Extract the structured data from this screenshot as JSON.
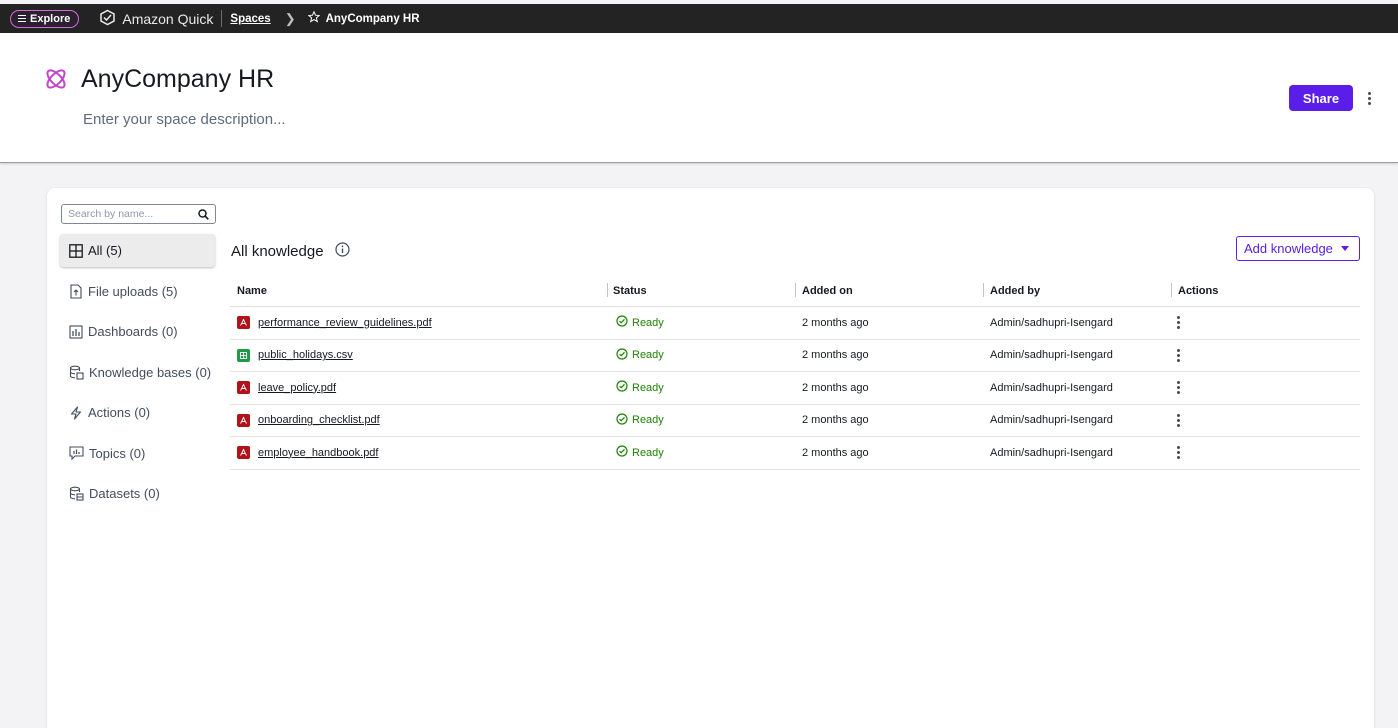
{
  "topbar": {
    "explore_label": "Explore",
    "brand": "Amazon Quick",
    "breadcrumb_spaces": "Spaces",
    "breadcrumb_current": "AnyCompany HR"
  },
  "header": {
    "title": "AnyCompany HR",
    "description_placeholder": "Enter your space description...",
    "share_label": "Share"
  },
  "search": {
    "placeholder": "Search by name..."
  },
  "sidebar": {
    "items": [
      {
        "label": "All (5)",
        "icon": "grid-icon",
        "active": true
      },
      {
        "label": "File uploads (5)",
        "icon": "file-upload-icon"
      },
      {
        "label": "Dashboards (0)",
        "icon": "dashboard-icon"
      },
      {
        "label": "Knowledge bases (0)",
        "icon": "knowledge-base-icon"
      },
      {
        "label": "Actions (0)",
        "icon": "lightning-icon"
      },
      {
        "label": "Topics (0)",
        "icon": "topic-icon"
      },
      {
        "label": "Datasets (0)",
        "icon": "dataset-icon"
      }
    ]
  },
  "main": {
    "section_title": "All knowledge",
    "add_button_label": "Add knowledge",
    "columns": [
      "Name",
      "Status",
      "Added on",
      "Added by",
      "Actions"
    ],
    "rows": [
      {
        "name": "performance_review_guidelines.pdf",
        "type": "pdf",
        "status": "Ready",
        "added_on": "2 months ago",
        "added_by": "Admin/sadhupri-Isengard"
      },
      {
        "name": "public_holidays.csv",
        "type": "csv",
        "status": "Ready",
        "added_on": "2 months ago",
        "added_by": "Admin/sadhupri-Isengard"
      },
      {
        "name": "leave_policy.pdf",
        "type": "pdf",
        "status": "Ready",
        "added_on": "2 months ago",
        "added_by": "Admin/sadhupri-Isengard"
      },
      {
        "name": "onboarding_checklist.pdf",
        "type": "pdf",
        "status": "Ready",
        "added_on": "2 months ago",
        "added_by": "Admin/sadhupri-Isengard"
      },
      {
        "name": "employee_handbook.pdf",
        "type": "pdf",
        "status": "Ready",
        "added_on": "2 months ago",
        "added_by": "Admin/sadhupri-Isengard"
      }
    ]
  },
  "colors": {
    "accent": "#5b1ee8",
    "topbar": "#232323",
    "status_ready": "#1d8102",
    "pdf_icon": "#b0131a",
    "csv_icon": "#1f9a4a"
  }
}
